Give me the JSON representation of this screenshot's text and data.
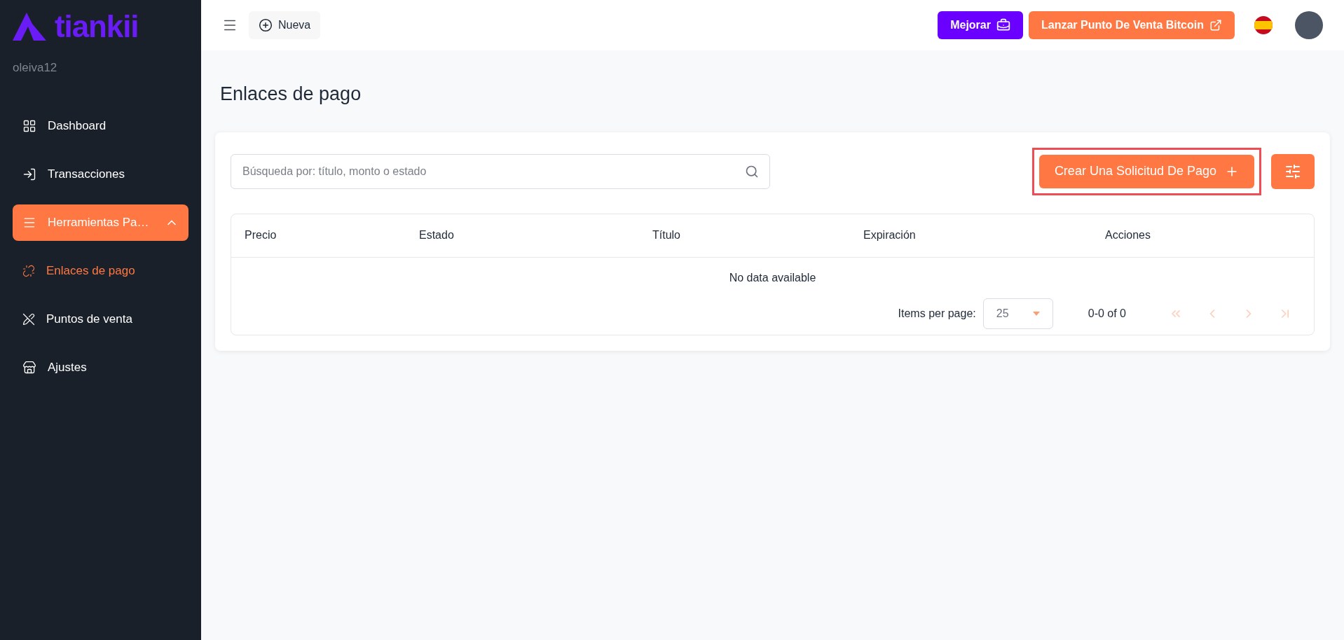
{
  "sidebar": {
    "brand": "tiankii",
    "username": "oleiva12",
    "items": [
      {
        "kind": "item",
        "label": "Dashboard",
        "selected": false
      },
      {
        "kind": "item",
        "label": "Transacciones",
        "selected": false
      },
      {
        "kind": "group",
        "label": "Herramientas Pa…",
        "selected": true,
        "expanded": true,
        "children": [
          {
            "label": "Enlaces de pago",
            "selected": true
          },
          {
            "label": "Puntos de venta",
            "selected": false
          }
        ]
      },
      {
        "kind": "item",
        "label": "Ajustes",
        "selected": false
      }
    ]
  },
  "topbar": {
    "new_button": "Nueva",
    "upgrade_button": "Mejorar",
    "launch_button": "Lanzar Punto De Venta Bitcoin"
  },
  "page_title": "Enlaces de pago",
  "search": {
    "placeholder": "Búsqueda por: título, monto o estado"
  },
  "create_button": {
    "label": "Crear Una Solicitud De Pago",
    "highlighted": true
  },
  "table": {
    "columns": [
      "Precio",
      "Estado",
      "Título",
      "Expiración",
      "Acciones"
    ],
    "empty_text": "No data available"
  },
  "pagination": {
    "items_per_page_label": "Items per page:",
    "items_per_page": "25",
    "range": "0-0 of 0",
    "buttons": [
      {
        "kind": "first",
        "disabled": true
      },
      {
        "kind": "prev",
        "disabled": true
      },
      {
        "kind": "next",
        "disabled": true
      },
      {
        "kind": "last",
        "disabled": true
      }
    ]
  }
}
